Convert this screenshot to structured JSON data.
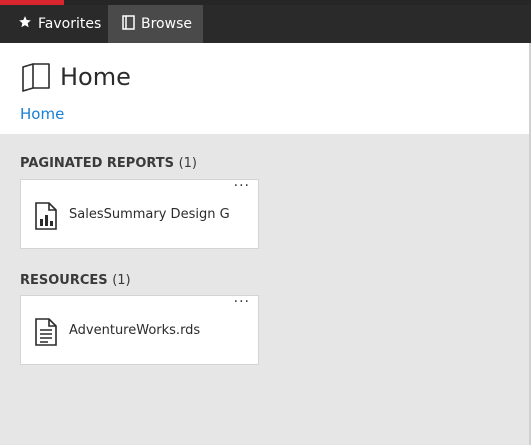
{
  "nav": {
    "favorites_label": "Favorites",
    "browse_label": "Browse",
    "favorites_icon": "star-icon",
    "browse_icon": "folder-icon"
  },
  "header": {
    "title": "Home",
    "breadcrumb": "Home",
    "icon": "home-folder-icon"
  },
  "sections": [
    {
      "title": "PAGINATED REPORTS",
      "count": "(1)",
      "items": [
        {
          "label": "SalesSummary Design Gri",
          "icon": "report-icon",
          "more": "···"
        }
      ]
    },
    {
      "title": "RESOURCES",
      "count": "(1)",
      "items": [
        {
          "label": "AdventureWorks.rds",
          "icon": "document-icon",
          "more": "···"
        }
      ]
    }
  ],
  "colors": {
    "accent": "#d9262e",
    "nav_bg": "#2a2a2a",
    "nav_active": "#4a4a4a",
    "link": "#1a7fd4",
    "content_bg": "#e6e6e6"
  }
}
